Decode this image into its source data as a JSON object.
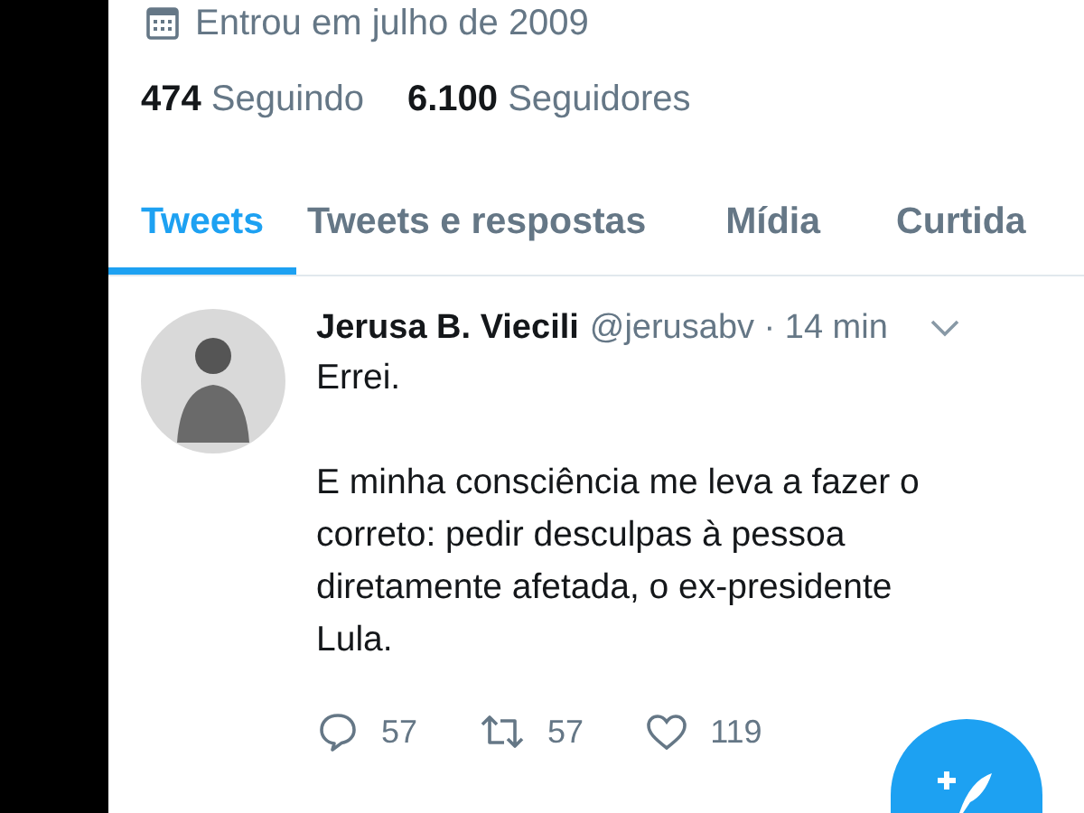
{
  "profile": {
    "joined": "Entrou em julho de 2009",
    "following_count": "474",
    "following_label": "Seguindo",
    "followers_count": "6.100",
    "followers_label": "Seguidores"
  },
  "tabs": [
    {
      "label": "Tweets",
      "selected": true
    },
    {
      "label": "Tweets e respostas",
      "selected": false
    },
    {
      "label": "Mídia",
      "selected": false
    },
    {
      "label": "Curtida",
      "selected": false
    }
  ],
  "tweet": {
    "name": "Jerusa B. Viecili",
    "handle": "@jerusabv · 14 min",
    "text": "Errei.\n\nE minha consciência me leva a fazer o\ncorreto: pedir desculpas à pessoa\ndiretamente afetada, o ex-presidente\nLula.",
    "replies": "57",
    "retweets": "57",
    "likes": "119"
  }
}
